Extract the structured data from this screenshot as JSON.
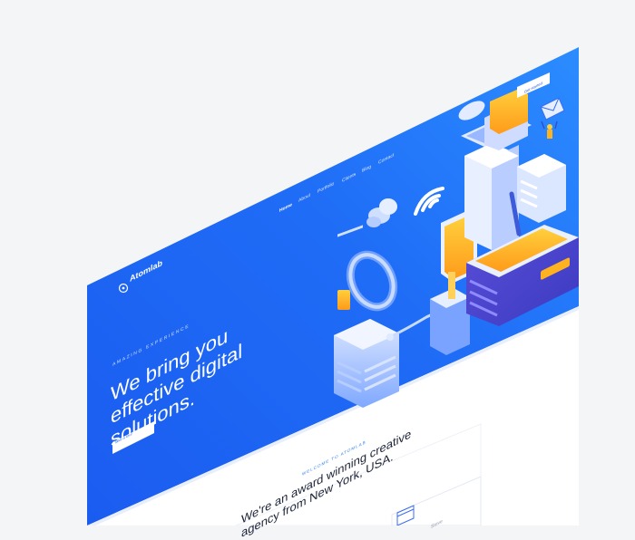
{
  "brand": {
    "name": "Atomlab"
  },
  "nav": {
    "items": [
      "Home",
      "About",
      "Portfolio",
      "Clients",
      "Blog",
      "Contact"
    ]
  },
  "header": {
    "cta_label": "Get started"
  },
  "hero": {
    "tagline": "AMAZING EXPERIENCE",
    "headline": "We bring you effective digital solutions.",
    "button_label": "Take a tour"
  },
  "about": {
    "eyebrow": "WELCOME TO ATOMLAB",
    "title": "We're an award winning creative agency from New York, USA.",
    "card_label": "Strive"
  },
  "colors": {
    "hero_blue_dark": "#1b4fe8",
    "hero_blue_light": "#2f86ff",
    "accent_orange": "#ffb21f",
    "background": "#f4f5f7"
  }
}
